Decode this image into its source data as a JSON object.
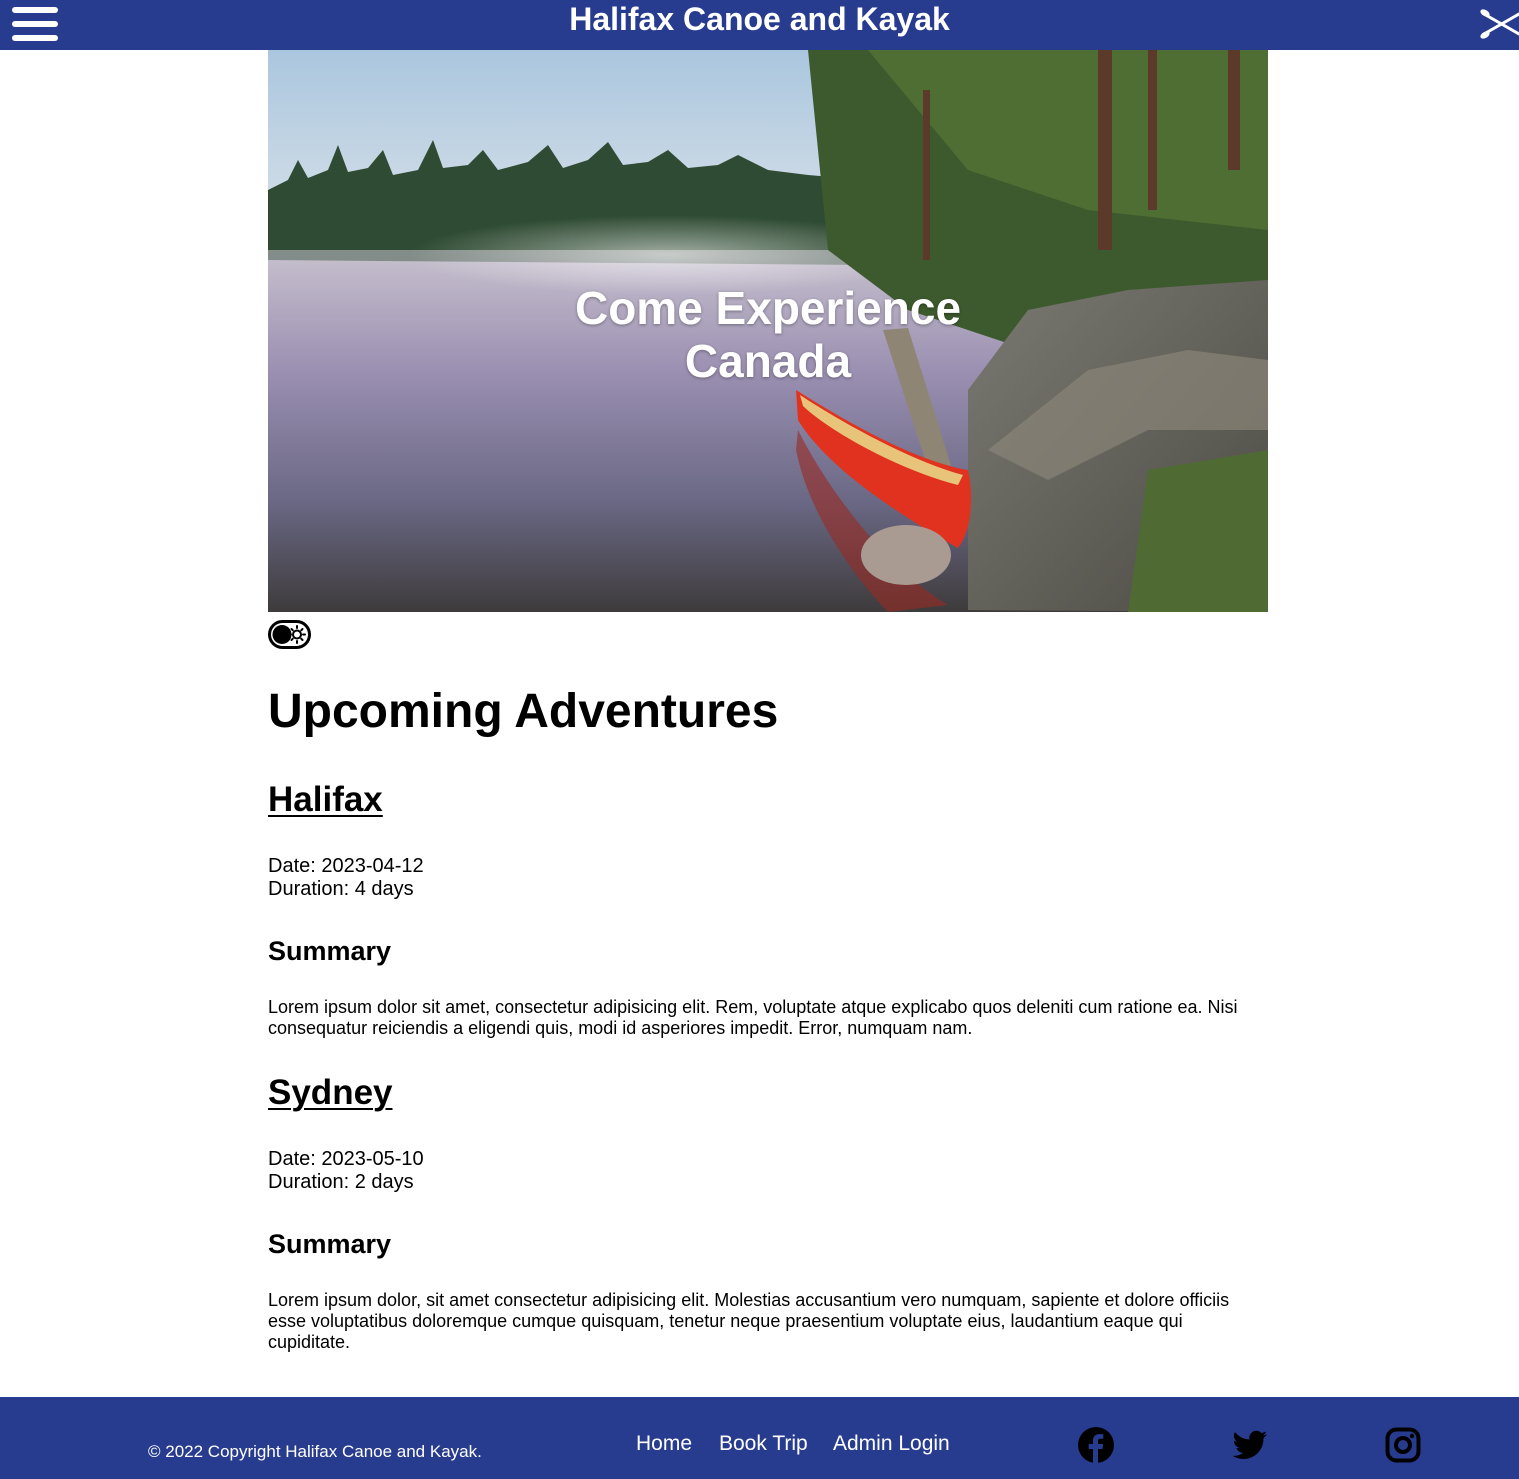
{
  "header": {
    "title": "Halifax Canoe and Kayak",
    "menu_icon": "hamburger-menu-icon",
    "paddle_icon": "crossed-paddles-icon"
  },
  "hero": {
    "line1": "Come Experience",
    "line2": "Canada",
    "image": "misty lake with red canoe on rocky shore"
  },
  "theme_toggle": {
    "icon": "dark-mode-toggle-icon"
  },
  "main": {
    "heading": "Upcoming Adventures",
    "trips": [
      {
        "name": "Halifax",
        "date": "Date: 2023-04-12",
        "duration": "Duration: 4 days",
        "summary_heading": "Summary",
        "summary": "Lorem ipsum dolor sit amet, consectetur adipisicing elit. Rem, voluptate atque explicabo quos deleniti cum ratione ea. Nisi consequatur reiciendis a eligendi quis, modi id asperiores impedit. Error, numquam nam."
      },
      {
        "name": "Sydney",
        "date": "Date: 2023-05-10",
        "duration": "Duration: 2 days",
        "summary_heading": "Summary",
        "summary": "Lorem ipsum dolor, sit amet consectetur adipisicing elit. Molestias accusantium vero numquam, sapiente et dolore officiis esse voluptatibus doloremque cumque quisquam, tenetur neque praesentium voluptate eius, laudantium eaque qui cupiditate."
      }
    ]
  },
  "footer": {
    "copyright": "© 2022 Copyright Halifax Canoe and Kayak.",
    "links": [
      "Home",
      "Book Trip",
      "Admin Login"
    ],
    "social_icons": [
      "facebook-icon",
      "twitter-icon",
      "instagram-icon"
    ]
  },
  "colors": {
    "brand": "#283c8f",
    "text": "#000000",
    "background": "#ffffff",
    "canoe": "#e0321e"
  }
}
